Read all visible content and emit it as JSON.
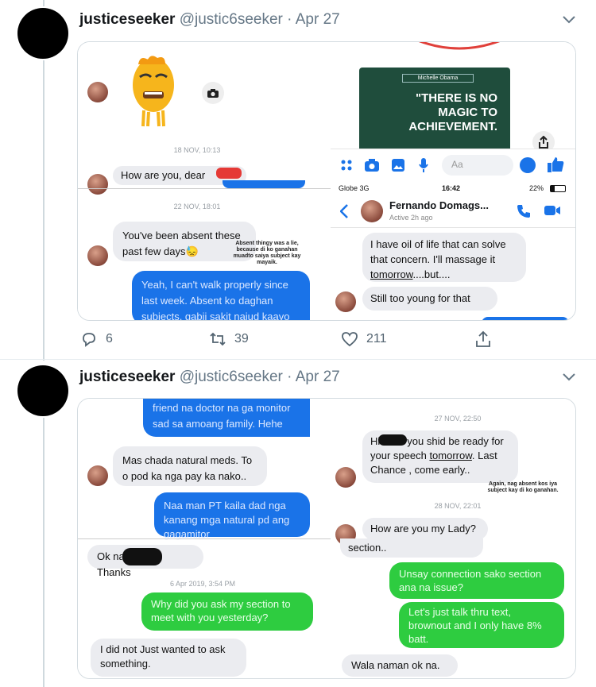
{
  "tweets": [
    {
      "name": "justiceseeker",
      "handle": "@justic6seeker",
      "separator": "·",
      "date": "Apr 27",
      "actions": {
        "replies": "6",
        "retweets": "39",
        "likes": "211"
      },
      "screenshots": {
        "left": {
          "timestamp_1": "18 NOV, 10:13",
          "msg_1": "How are you, dear",
          "timestamp_2": "22 NOV, 18:01",
          "msg_2_line1": "You've been absent these",
          "msg_2_line2": "past few days",
          "msg_2_emoji": "😓",
          "note": "Absent thingy was a lie, because di ko ganahan muadto saiya subject kay mayaik.",
          "msg_3": "Yeah, I can't walk properly since last week. Absent ko daghan subjects, gabii sakit najud kaayo"
        },
        "right": {
          "quote_author": "Michelle Obama",
          "quote_text": "\"THERE IS NO MAGIC TO ACHIEVEMENT.",
          "compose_placeholder": "Aa",
          "status_carrier": "Globe 3G",
          "status_time": "16:42",
          "status_battery": "22%",
          "contact_name": "Fernando Domags...",
          "contact_status": "Active 2h ago",
          "msg_1_a": "I have oil of life that can solve that concern. I'll massage it ",
          "msg_1_b": "tomorrow",
          "msg_1_c": "....but....",
          "msg_2": "Still too young for that"
        }
      }
    },
    {
      "name": "justiceseeker",
      "handle": "@justic6seeker",
      "separator": "·",
      "date": "Apr 27",
      "screenshots": {
        "left": {
          "msg_1": "friend na doctor na ga monitor sad sa amoang family. Hehe",
          "msg_2": "Mas chada natural meds. To o pod ka nga pay ka nako..",
          "msg_3": "Naa man PT kaila dad nga kanang mga natural pd ang gagamitor",
          "msg_4_a": "Ok na",
          "msg_4_b": "Thanks",
          "timestamp": "6 Apr 2019, 3:54 PM",
          "msg_5": "Why did you ask my section to meet with you yesterday?",
          "msg_6": "I did not Just wanted to ask something."
        },
        "right": {
          "timestamp_1": "27 NOV, 22:50",
          "msg_1_a": "Hi",
          "msg_1_b": "you shid be ready for your speech ",
          "msg_1_c": "tomorrow",
          "msg_1_d": ". Last Chance , come early..",
          "note": "Again, nag absent kos iya subject kay di ko ganahan.",
          "timestamp_2": "28 NOV, 22:01",
          "msg_2": "How are you my Lady?",
          "msg_3": "section..",
          "msg_4": "Unsay connection sako section ana na issue?",
          "msg_5": "Let's just talk thru text, brownout and I only have 8% batt.",
          "msg_6": "Wala naman ok na."
        }
      }
    }
  ]
}
